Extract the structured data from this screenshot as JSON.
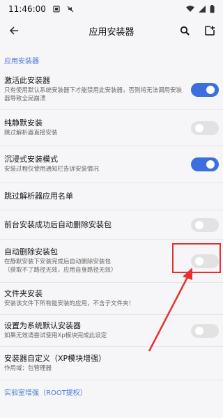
{
  "status": {
    "time": "11:46:00"
  },
  "header": {
    "title": "应用安装器"
  },
  "sections": [
    {
      "title": "应用安装器"
    },
    {
      "title": "实验室增强（ROOT提权）"
    }
  ],
  "settings": [
    {
      "title": "激活此安装器",
      "desc": "只有使用默认系统安装器下才能禁用此安装器，否则将无法调用安装器导致全局崩溃",
      "enabled": true
    },
    {
      "title": "纯静默安装",
      "desc": "跳过解析器直接安装",
      "enabled": false
    },
    {
      "title": "沉浸式安装模式",
      "desc": "安装过程仅使用通知栏告诉安装情况",
      "enabled": true
    },
    {
      "title": "跳过解析器应用名单"
    },
    {
      "title": "前台安装成功后自动删除安装包",
      "enabled": false
    },
    {
      "title": "自动删除安装包",
      "desc": "在静默安装下安装完成后自动删除安装包\n（获取不了路径无效，应用自身路径无效）",
      "enabled": false
    },
    {
      "title": "文件夹安装",
      "desc": "安装该文件下所有能安装的应用，不含子文件夹！"
    },
    {
      "title": "设置为系统默认安装器",
      "desc": "如果无效请尝试使用Xp模块完成此设定",
      "enabled": false
    },
    {
      "title": "安装器自定义（XP模块增强）",
      "desc": "作用域：包管理器"
    }
  ],
  "annotation": {
    "highlight_color": "#e63030"
  },
  "colors": {
    "accent": "#3b6fe0",
    "section": "#4b7ad8"
  }
}
